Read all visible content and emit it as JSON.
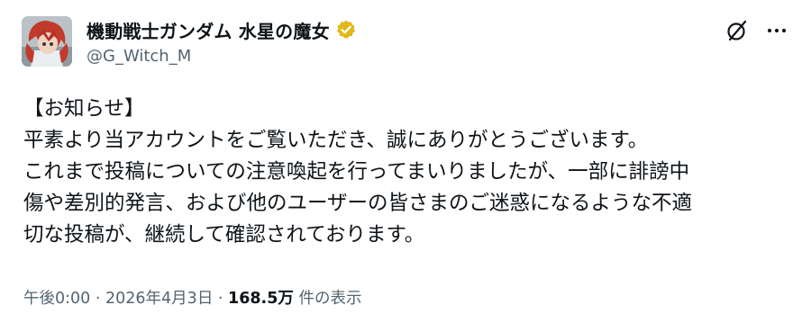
{
  "account": {
    "display_name": "機動戦士ガンダム 水星の魔女",
    "handle": "@G_Witch_M",
    "verified_color": "#e2b719"
  },
  "icons": {
    "verified": "verified-badge-icon",
    "grok": "grok-icon",
    "more": "more-horizontal-icon"
  },
  "post": {
    "lines": [
      "【お知らせ】",
      "平素より当アカウントをご覧いただき、誠にありがとうございます。",
      "これまで投稿についての注意喚起を行ってまいりましたが、一部に誹謗中",
      "傷や差別的発言、および他のユーザーの皆さまのご迷惑になるような不適",
      "切な投稿が、継続して確認されております。"
    ]
  },
  "meta": {
    "time": "午後0:00",
    "separator": " · ",
    "date": "2026年4月3日",
    "views": "168.5万",
    "views_suffix": " 件の表示"
  }
}
